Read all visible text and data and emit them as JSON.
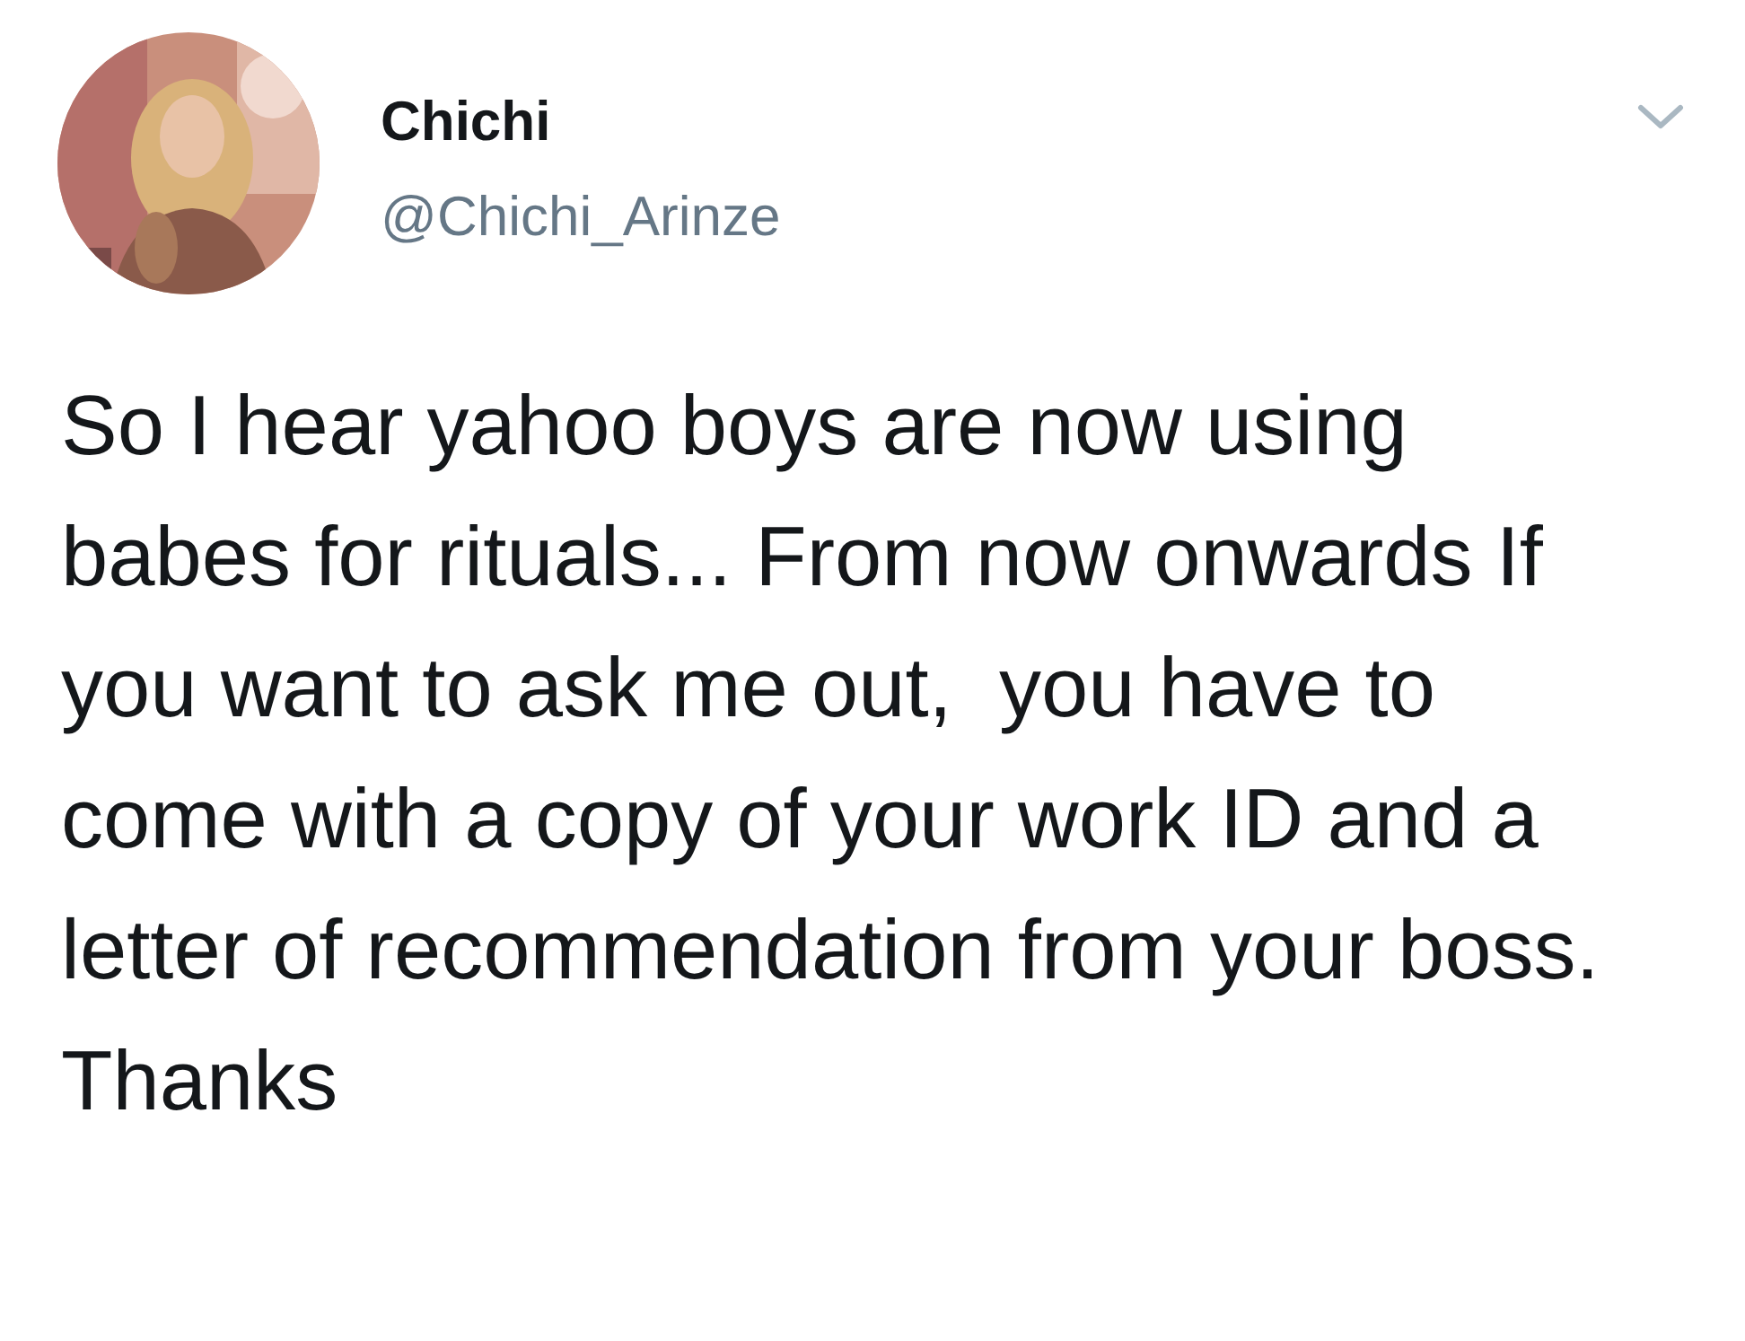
{
  "author": {
    "name": "Chichi",
    "handle": "@Chichi_Arinze"
  },
  "tweet": {
    "text": "So I hear yahoo boys are now using babes for rituals... From now onwards If you want to ask me out,  you have to come with a copy of your work ID and a letter of recommendation from your boss. Thanks"
  }
}
